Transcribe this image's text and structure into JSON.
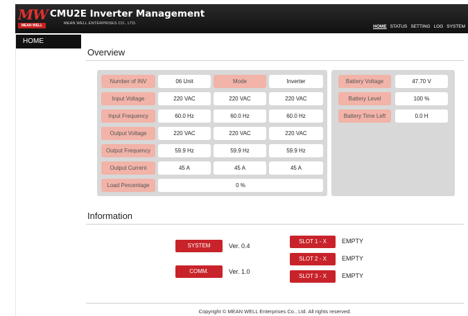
{
  "header": {
    "logo_text": "MW",
    "logo_sub": "MEAN WELL",
    "title": "CMU2E Inverter Management",
    "company": "MEAN WELL ENTERPRISES CO., LTD.",
    "nav": [
      "HOME",
      "STATUS",
      "SETTING",
      "LOG",
      "SYSTEM"
    ]
  },
  "sidebar": {
    "home": "HOME"
  },
  "overview": {
    "title": "Overview",
    "number_of_inv_label": "Number of INV",
    "number_of_inv_value": "06 Unit",
    "mode_label": "Mode",
    "mode_value": "Inverter",
    "rows": [
      {
        "label": "Input Voltage",
        "values": [
          "220 VAC",
          "220 VAC",
          "220 VAC"
        ]
      },
      {
        "label": "Input Frequency",
        "values": [
          "60.0 Hz",
          "60.0 Hz",
          "60.0 Hz"
        ]
      },
      {
        "label": "Output Voltage",
        "values": [
          "220 VAC",
          "220 VAC",
          "220 VAC"
        ]
      },
      {
        "label": "Output Frequency",
        "values": [
          "59.9 Hz",
          "59.9 Hz",
          "59.9 Hz"
        ]
      },
      {
        "label": "Output Current",
        "values": [
          "45 A",
          "45 A",
          "45 A"
        ]
      }
    ],
    "load_label": "Load Percentage",
    "load_value": "0 %",
    "battery": [
      {
        "label": "Battery Voltage",
        "value": "47.70 V"
      },
      {
        "label": "Battery Level",
        "value": "100 %"
      },
      {
        "label": "Battery Time Left",
        "value": "0.0 H"
      }
    ]
  },
  "information": {
    "title": "Information",
    "system_label": "SYSTEM",
    "system_version": "Ver. 0.4",
    "comm_label": "COMM.",
    "comm_version": "Ver. 1.0",
    "slots": [
      {
        "label": "SLOT 1 - X",
        "status": "EMPTY"
      },
      {
        "label": "SLOT 2 - X",
        "status": "EMPTY"
      },
      {
        "label": "SLOT 3 - X",
        "status": "EMPTY"
      }
    ]
  },
  "footer": "Copyright © MEAN WELL Enterprises Co., Ltd. All rights reserved.",
  "colors": {
    "accent_red": "#c8232a",
    "label_pink": "#f2b3a8",
    "panel_gray": "#d8d8d8"
  }
}
